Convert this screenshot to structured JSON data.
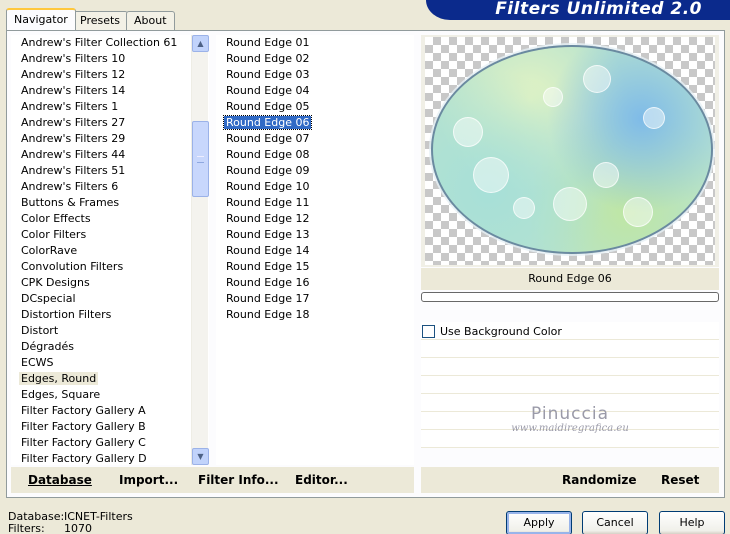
{
  "window": {
    "title": "Filters Unlimited 2.0"
  },
  "tabs": [
    {
      "label": "Navigator",
      "active": true
    },
    {
      "label": "Presets",
      "active": false
    },
    {
      "label": "About",
      "active": false
    }
  ],
  "categories": {
    "selected_index": 21,
    "items": [
      "Andrew's Filter Collection 61",
      "Andrew's Filters 10",
      "Andrew's Filters 12",
      "Andrew's Filters 14",
      "Andrew's Filters 1",
      "Andrew's Filters 27",
      "Andrew's Filters 29",
      "Andrew's Filters 44",
      "Andrew's Filters 51",
      "Andrew's Filters 6",
      "Buttons & Frames",
      "Color Effects",
      "Color Filters",
      "ColorRave",
      "Convolution Filters",
      "CPK Designs",
      "DCspecial",
      "Distortion Filters",
      "Distort",
      "Dégradés",
      "ECWS",
      "Edges, Round",
      "Edges, Square",
      "Filter Factory Gallery A",
      "Filter Factory Gallery B",
      "Filter Factory Gallery C",
      "Filter Factory Gallery D"
    ]
  },
  "filters": {
    "selected_index": 5,
    "items": [
      "Round Edge 01",
      "Round Edge 02",
      "Round Edge 03",
      "Round Edge 04",
      "Round Edge 05",
      "Round Edge 06",
      "Round Edge 07",
      "Round Edge 08",
      "Round Edge 09",
      "Round Edge 10",
      "Round Edge 11",
      "Round Edge 12",
      "Round Edge 13",
      "Round Edge 14",
      "Round Edge 15",
      "Round Edge 16",
      "Round Edge 17",
      "Round Edge 18"
    ]
  },
  "preview": {
    "label": "Round Edge 06",
    "progress": 0,
    "use_background_color_label": "Use Background Color",
    "use_background_color_checked": false,
    "watermark_name": "Pinuccia",
    "watermark_url": "www.maidiregrafica.eu"
  },
  "left_buttons": {
    "database": "Database",
    "import": "Import...",
    "filter_info": "Filter Info...",
    "editor": "Editor..."
  },
  "right_buttons": {
    "randomize": "Randomize",
    "reset": "Reset"
  },
  "status": {
    "database_label": "Database:",
    "database_value": "ICNET-Filters",
    "filters_label": "Filters:",
    "filters_value": "1070"
  },
  "dialog_buttons": {
    "apply": "Apply",
    "cancel": "Cancel",
    "help": "Help"
  },
  "colors": {
    "title_banner": "#0b2a8c",
    "selection": "#316ac5",
    "dialog_bg": "#ece9d8"
  }
}
